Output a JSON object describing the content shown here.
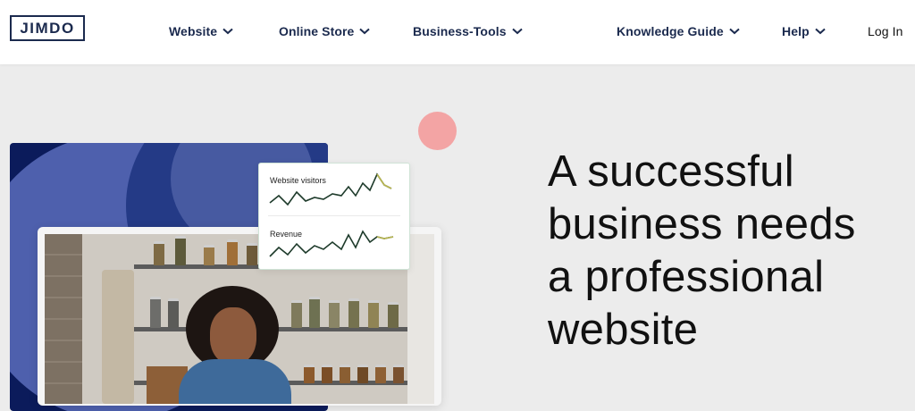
{
  "brand": {
    "logo_text": "JIMDO"
  },
  "nav": {
    "items": [
      {
        "label": "Website"
      },
      {
        "label": "Online Store"
      },
      {
        "label": "Business-Tools"
      },
      {
        "label": "Knowledge Guide"
      },
      {
        "label": "Help"
      }
    ],
    "login_label": "Log In"
  },
  "stats_card": {
    "visitors_label": "Website visitors",
    "revenue_label": "Revenue"
  },
  "hero": {
    "headline_lines": [
      "A successful",
      "business needs",
      "a professional",
      "website"
    ]
  },
  "colors": {
    "navy": "#1b2a4e",
    "accent_pink": "#f3a4a4",
    "card_dark": "#0b1b5b",
    "background": "#ececec"
  },
  "icons": {
    "dropdown": "chevron-down-icon"
  }
}
